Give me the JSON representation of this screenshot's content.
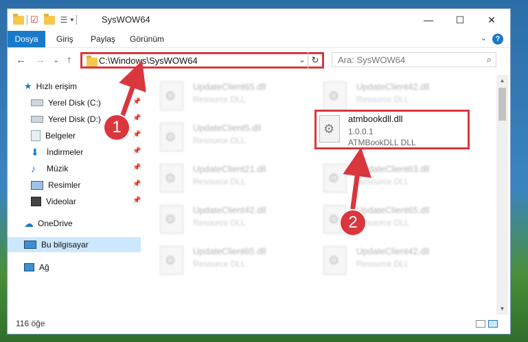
{
  "window": {
    "title": "SysWOW64",
    "controls": {
      "minimize": "—",
      "maximize": "☐",
      "close": "✕"
    }
  },
  "ribbon": {
    "tabs": [
      "Dosya",
      "Giriş",
      "Paylaş",
      "Görünüm"
    ],
    "help": "?"
  },
  "navbar": {
    "back": "←",
    "forward": "→",
    "recent": "⌄",
    "up": "↑",
    "address": "C:\\Windows\\SysWOW64",
    "refresh": "↻",
    "dropdown": "⌄",
    "search_placeholder": "Ara: SysWOW64",
    "search_icon": "⌕"
  },
  "sidebar": {
    "quick_access": "Hızlı erişim",
    "items": [
      {
        "label": "Yerel Disk (C:)",
        "icon": "drive-icon",
        "pinned": true
      },
      {
        "label": "Yerel Disk (D:)",
        "icon": "drive-icon",
        "pinned": true
      },
      {
        "label": "Belgeler",
        "icon": "documents-icon",
        "pinned": true
      },
      {
        "label": "İndirmeler",
        "icon": "downloads-icon",
        "pinned": true
      },
      {
        "label": "Müzik",
        "icon": "music-icon",
        "pinned": true
      },
      {
        "label": "Resimler",
        "icon": "pictures-icon",
        "pinned": true
      },
      {
        "label": "Videolar",
        "icon": "videos-icon",
        "pinned": true
      }
    ],
    "onedrive": "OneDrive",
    "this_pc": "Bu bilgisayar",
    "network": "Ağ"
  },
  "files_left": [
    {
      "name": "UpdateClient65.dll",
      "type": "Resource DLL"
    },
    {
      "name": "UpdateClient5.dll",
      "type": "Resource DLL"
    },
    {
      "name": "UpdateClient21.dll",
      "type": "Resource DLL"
    },
    {
      "name": "UpdateClient42.dll",
      "type": "Resource DLL"
    },
    {
      "name": "UpdateClient65.dll",
      "type": "Resource DLL"
    }
  ],
  "files_right": [
    {
      "name": "UpdateClient42.dll",
      "type": "Resource DLL"
    },
    {
      "name": "UpdateClient63.dll",
      "type": "Resource DLL"
    },
    {
      "name": "UpdateClient65.dll",
      "type": "Resource DLL"
    },
    {
      "name": "UpdateClient42.dll",
      "type": "Resource DLL"
    }
  ],
  "highlighted_file": {
    "name": "atmbookdll.dll",
    "version": "1.0.0.1",
    "description": "ATMBookDLL DLL"
  },
  "status": {
    "item_count": "116 öğe"
  },
  "annotations": {
    "step1": "1",
    "step2": "2",
    "color": "#d9363e"
  }
}
